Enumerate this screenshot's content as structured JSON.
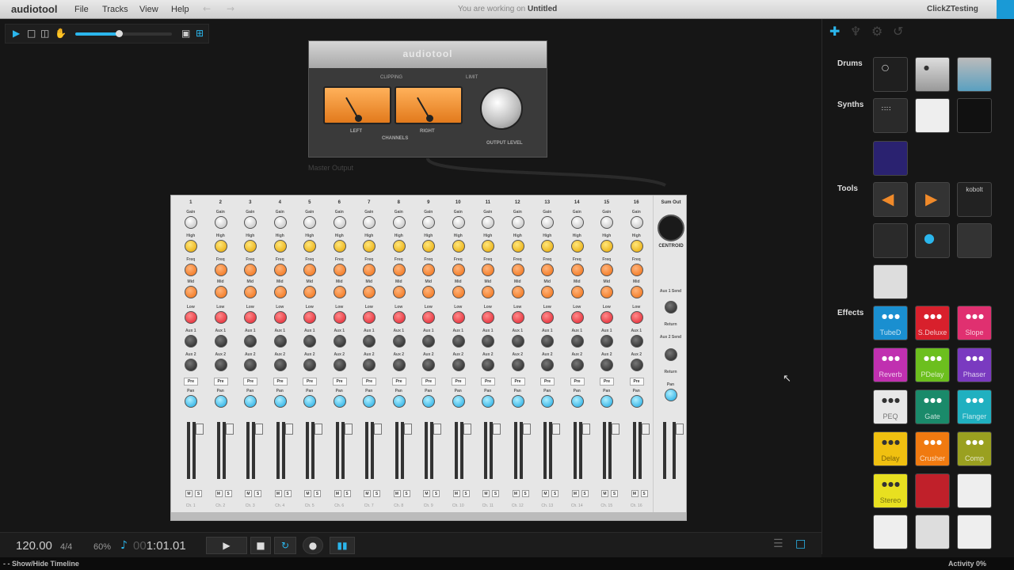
{
  "menubar": {
    "logo": "audiotool",
    "menus": [
      "File",
      "Tracks",
      "View",
      "Help"
    ],
    "status_prefix": "You are working on",
    "status_project": "Untitled",
    "user": "ClickZTesting"
  },
  "toolbar": {
    "tools": [
      "pointer-icon",
      "marquee-icon",
      "headphones-icon",
      "hand-icon"
    ],
    "zoom_level": 0.45
  },
  "master": {
    "brand": "audiotool",
    "clipping": "CLIPPING",
    "limit": "LIMIT",
    "left": "LEFT",
    "right": "RIGHT",
    "channels": "CHANNELS",
    "output_level": "OUTPUT LEVEL",
    "label": "Master Output"
  },
  "mixer": {
    "channels": [
      "1",
      "2",
      "3",
      "4",
      "5",
      "6",
      "7",
      "8",
      "9",
      "10",
      "11",
      "12",
      "13",
      "14",
      "15",
      "16"
    ],
    "channel_names": [
      "Ch. 1",
      "Ch. 2",
      "Ch. 3",
      "Ch. 4",
      "Ch. 5",
      "Ch. 6",
      "Ch. 7",
      "Ch. 8",
      "Ch. 9",
      "Ch. 10",
      "Ch. 11",
      "Ch. 12",
      "Ch. 13",
      "Ch. 14",
      "Ch. 15",
      "Ch. 16"
    ],
    "knob_labels": [
      "Gain",
      "High",
      "Freq",
      "Mid",
      "Low",
      "Aux 1",
      "Aux 2"
    ],
    "pre": "Pre",
    "pan": "Pan",
    "mute": "M",
    "solo": "S",
    "sum_out": "Sum Out",
    "centroid": "CENTROID",
    "aux1_send": "Aux 1 Send",
    "aux2_send": "Aux 2 Send",
    "return": "Return"
  },
  "rpanel": {
    "categories": {
      "drums": "Drums",
      "synths": "Synths",
      "tools": "Tools",
      "effects": "Effects"
    },
    "effects": [
      {
        "label": "TubeD",
        "color": "#1a8fd0"
      },
      {
        "label": "S.Deluxe",
        "color": "#d8202c"
      },
      {
        "label": "Slope",
        "color": "#e03070"
      },
      {
        "label": "Reverb",
        "color": "#c030b0"
      },
      {
        "label": "PDelay",
        "color": "#6cbf1e"
      },
      {
        "label": "Phaser",
        "color": "#7a3ac0"
      },
      {
        "label": "PEQ",
        "color": "#e8e8e8"
      },
      {
        "label": "Gate",
        "color": "#1a8a6a"
      },
      {
        "label": "Flanger",
        "color": "#20b0c0"
      },
      {
        "label": "Delay",
        "color": "#f0c010"
      },
      {
        "label": "Crusher",
        "color": "#f07a10"
      },
      {
        "label": "Comp",
        "color": "#9aa020"
      },
      {
        "label": "Stereo",
        "color": "#e8e020"
      }
    ],
    "kobolt": "kobolt"
  },
  "transport": {
    "bpm": "120.00",
    "signature": "4/4",
    "swing": "60%",
    "position_dim": "00",
    "position": "1:01.01"
  },
  "statusbar": {
    "left": "Show/Hide Timeline",
    "right": "Activity 0%"
  },
  "colors": {
    "accent": "#2bb6ec",
    "meter": "#f08a2a"
  }
}
